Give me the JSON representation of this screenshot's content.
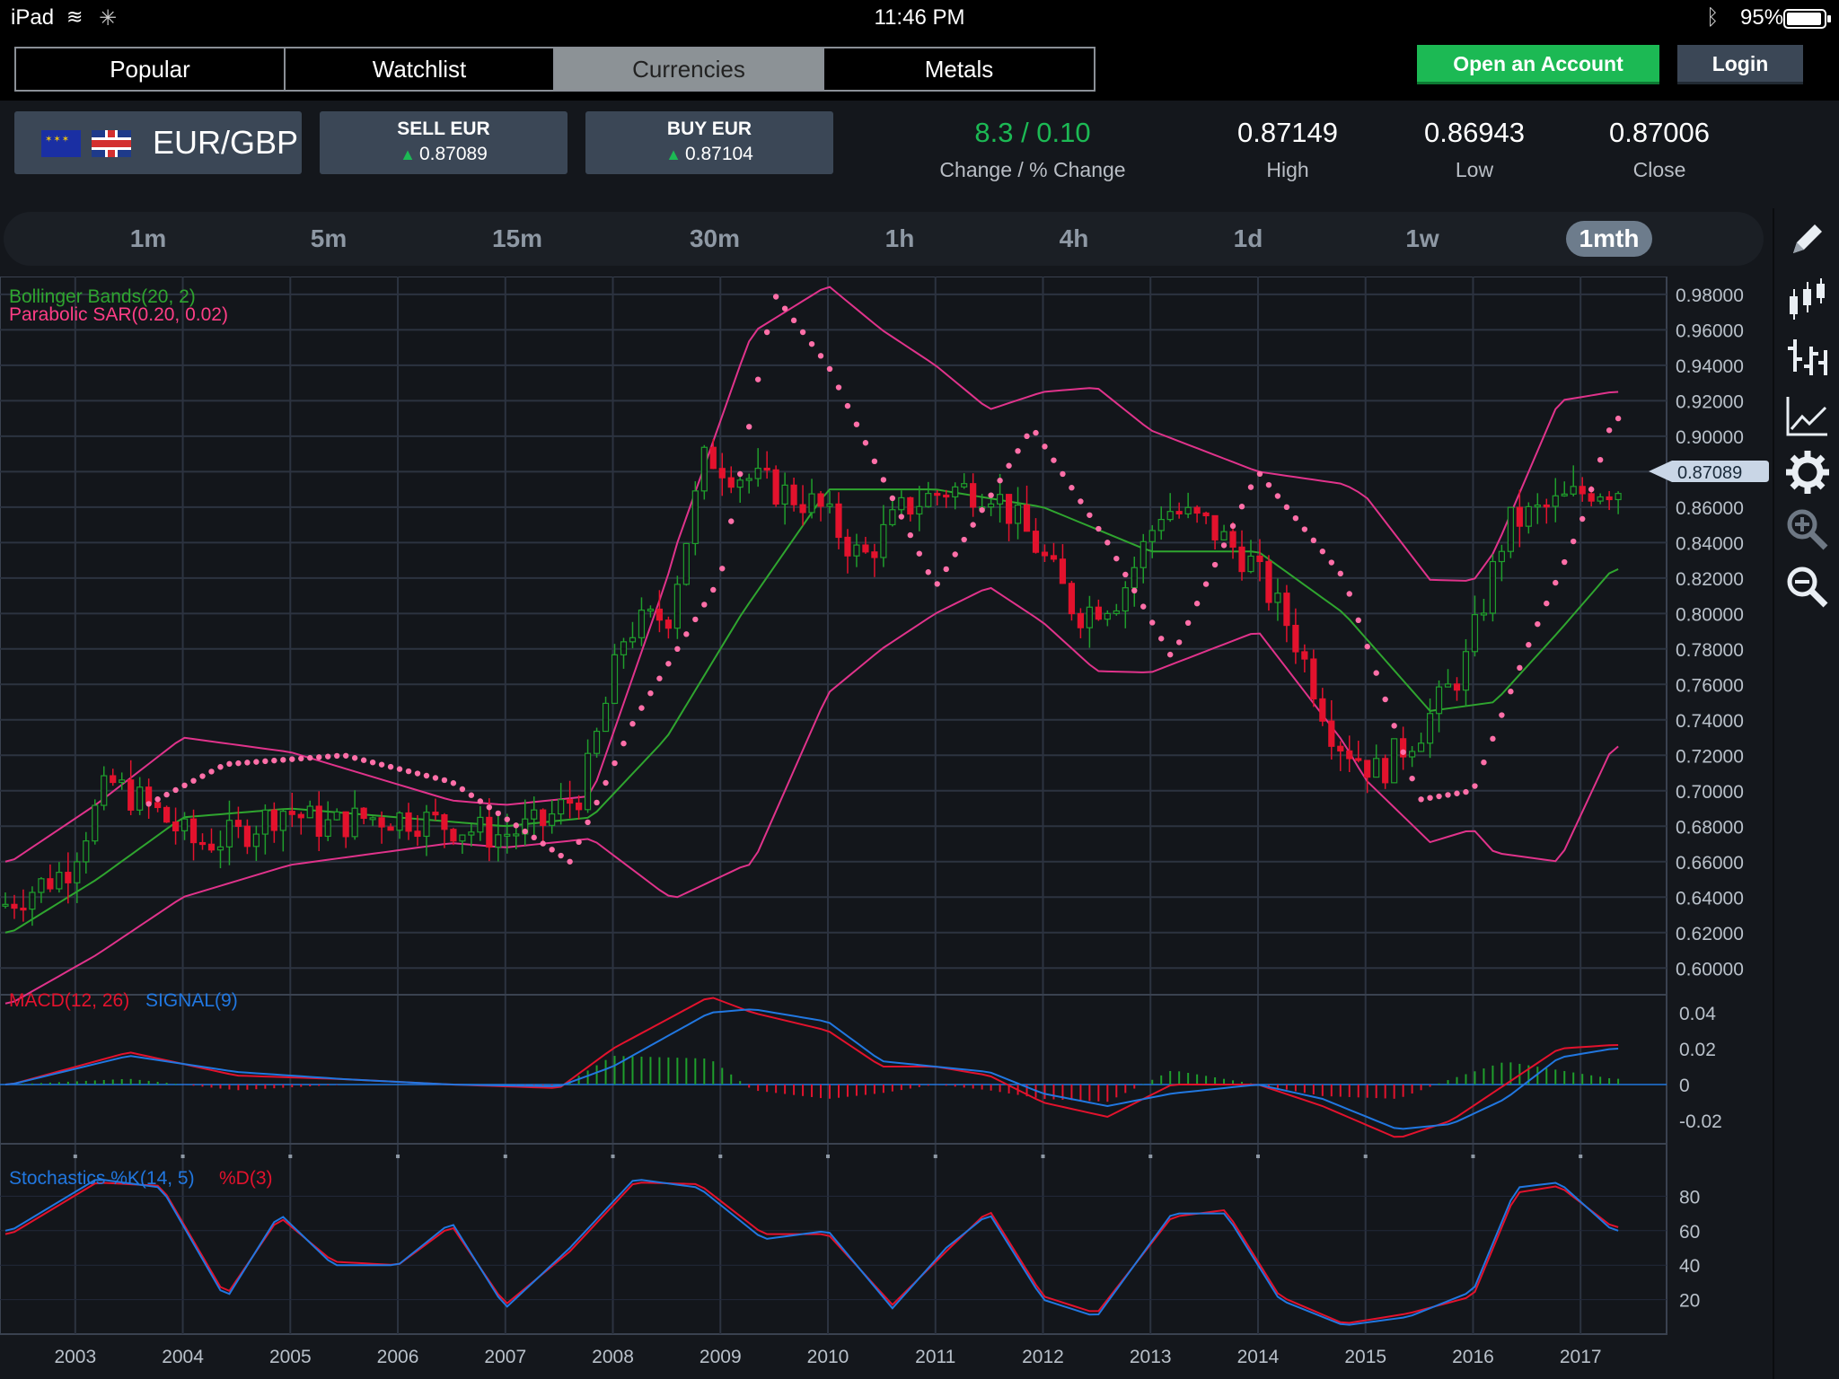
{
  "status_bar": {
    "device": "iPad",
    "time": "11:46 PM",
    "battery": "95%"
  },
  "nav": {
    "tabs": [
      {
        "label": "Popular",
        "active": false
      },
      {
        "label": "Watchlist",
        "active": false
      },
      {
        "label": "Currencies",
        "active": true
      },
      {
        "label": "Metals",
        "active": false
      }
    ],
    "open_account": "Open an Account",
    "login": "Login"
  },
  "instrument": {
    "pair": "EUR/GBP",
    "sell_label": "SELL EUR",
    "sell_price": "0.87089",
    "buy_label": "BUY EUR",
    "buy_price": "0.87104",
    "change": "8.3 / 0.10",
    "change_label": "Change / % Change",
    "high": "0.87149",
    "high_label": "High",
    "low": "0.86943",
    "low_label": "Low",
    "close": "0.87006",
    "close_label": "Close"
  },
  "timeframes": [
    "1m",
    "5m",
    "15m",
    "30m",
    "1h",
    "4h",
    "1d",
    "1w",
    "1mth"
  ],
  "active_timeframe": "1mth",
  "tools": [
    "pencil-icon",
    "candlestick-icon",
    "ohlc-bars-icon",
    "line-chart-icon",
    "settings-gear-icon",
    "zoom-in-icon",
    "zoom-out-icon"
  ],
  "colors": {
    "up": "#1f9e2c",
    "down": "#e3122d",
    "boll_mid": "#2fa52f",
    "boll_band": "#e0338b",
    "sar": "#ff6fa8",
    "macd": "#e3122d",
    "signal": "#2177e0",
    "stoch_k": "#2177e0",
    "stoch_d": "#e3122d"
  },
  "chart_data": [
    {
      "type": "candlestick",
      "indicators_legend": [
        "Bollinger Bands(20, 2)",
        "Parabolic SAR(0.20, 0.02)"
      ],
      "current_price_label": "0.87089",
      "y_ticks": [
        "0.98000",
        "0.96000",
        "0.94000",
        "0.92000",
        "0.90000",
        "0.88000",
        "0.86000",
        "0.84000",
        "0.82000",
        "0.80000",
        "0.78000",
        "0.76000",
        "0.74000",
        "0.72000",
        "0.70000",
        "0.68000",
        "0.66000",
        "0.64000",
        "0.62000",
        "0.60000"
      ],
      "ylim": [
        0.59,
        0.985
      ],
      "x_ticks": [
        "2003",
        "2004",
        "2005",
        "2006",
        "2007",
        "2008",
        "2009",
        "2010",
        "2011",
        "2012",
        "2013",
        "2014",
        "2015",
        "2016",
        "2017"
      ],
      "xlim": [
        2002.3,
        2017.8
      ],
      "series": [
        {
          "name": "EUR/GBP",
          "x": [
            2002.4,
            2003.0,
            2003.4,
            2003.8,
            2004.2,
            2004.6,
            2005.0,
            2005.4,
            2005.8,
            2006.2,
            2006.6,
            2007.0,
            2007.4,
            2007.8,
            2008.2,
            2008.6,
            2008.95,
            2009.2,
            2009.6,
            2010.0,
            2010.4,
            2010.8,
            2011.2,
            2011.6,
            2012.0,
            2012.4,
            2012.8,
            2013.2,
            2013.6,
            2014.0,
            2014.4,
            2014.8,
            2015.2,
            2015.6,
            2016.0,
            2016.4,
            2016.8,
            2017.2
          ],
          "values": [
            0.635,
            0.655,
            0.705,
            0.69,
            0.67,
            0.675,
            0.69,
            0.68,
            0.685,
            0.685,
            0.68,
            0.675,
            0.68,
            0.7,
            0.79,
            0.8,
            0.89,
            0.88,
            0.87,
            0.86,
            0.83,
            0.86,
            0.87,
            0.87,
            0.84,
            0.8,
            0.81,
            0.86,
            0.85,
            0.83,
            0.79,
            0.73,
            0.71,
            0.735,
            0.77,
            0.85,
            0.86,
            0.87089
          ]
        },
        {
          "name": "Bollinger Bands(20, 2)",
          "x": [
            2002.4,
            2003.2,
            2004.0,
            2005.0,
            2006.0,
            2007.0,
            2007.8,
            2008.5,
            2009.2,
            2010.0,
            2011.0,
            2012.0,
            2013.0,
            2014.0,
            2014.8,
            2015.6,
            2016.2,
            2016.8,
            2017.3
          ],
          "values": [
            0.62,
            0.65,
            0.685,
            0.69,
            0.685,
            0.68,
            0.685,
            0.73,
            0.8,
            0.87,
            0.87,
            0.86,
            0.835,
            0.835,
            0.8,
            0.745,
            0.75,
            0.79,
            0.825
          ]
        },
        {
          "name": "Parabolic SAR(0.20, 0.02)",
          "x": [
            2003.6,
            2004.4,
            2005.5,
            2006.5,
            2007.6,
            2008.2,
            2009.0,
            2009.5,
            2010.0,
            2011.0,
            2011.9,
            2012.6,
            2013.2,
            2014.0,
            2014.8,
            2015.5,
            2016.0,
            2016.5,
            2017.0,
            2017.3
          ],
          "values": [
            0.69,
            0.715,
            0.72,
            0.705,
            0.66,
            0.74,
            0.82,
            0.98,
            0.94,
            0.815,
            0.905,
            0.84,
            0.775,
            0.88,
            0.82,
            0.695,
            0.7,
            0.78,
            0.85,
            0.91
          ]
        }
      ]
    },
    {
      "type": "line",
      "legend": [
        "MACD(12, 26)",
        "SIGNAL(9)"
      ],
      "y_ticks": [
        "0.04",
        "0.02",
        "0",
        "-0.02"
      ],
      "ylim": [
        -0.03,
        0.05
      ],
      "x": [
        2002.4,
        2003.5,
        2004.5,
        2005.5,
        2006.5,
        2007.5,
        2008.0,
        2008.9,
        2009.3,
        2010.0,
        2010.5,
        2011.0,
        2011.5,
        2012.0,
        2012.6,
        2013.2,
        2014.0,
        2014.6,
        2015.3,
        2015.8,
        2016.3,
        2016.8,
        2017.3
      ],
      "series": [
        {
          "name": "MACD(12, 26)",
          "values": [
            0.0,
            0.018,
            0.005,
            0.003,
            0.0,
            -0.002,
            0.02,
            0.049,
            0.04,
            0.03,
            0.01,
            0.01,
            0.005,
            -0.01,
            -0.018,
            0.0,
            0.0,
            -0.012,
            -0.03,
            -0.02,
            0.0,
            0.02,
            0.022
          ]
        },
        {
          "name": "SIGNAL(9)",
          "values": [
            0.0,
            0.016,
            0.007,
            0.003,
            0.0,
            -0.001,
            0.01,
            0.04,
            0.042,
            0.035,
            0.013,
            0.01,
            0.007,
            -0.005,
            -0.012,
            -0.005,
            0.0,
            -0.008,
            -0.025,
            -0.022,
            -0.008,
            0.015,
            0.02
          ]
        }
      ]
    },
    {
      "type": "line",
      "legend": [
        "Stochastics %K(14, 5)",
        "%D(3)"
      ],
      "y_ticks": [
        "80",
        "60",
        "40",
        "20"
      ],
      "ylim": [
        0,
        100
      ],
      "x": [
        2002.4,
        2003.2,
        2003.8,
        2004.4,
        2004.9,
        2005.4,
        2006.0,
        2006.5,
        2007.0,
        2007.6,
        2008.2,
        2008.8,
        2009.4,
        2010.0,
        2010.6,
        2011.1,
        2011.5,
        2012.0,
        2012.5,
        2013.2,
        2013.7,
        2014.2,
        2014.8,
        2015.4,
        2016.0,
        2016.4,
        2016.8,
        2017.3
      ],
      "series": [
        {
          "name": "Stochastics %K(14, 5)",
          "values": [
            60,
            90,
            85,
            20,
            70,
            40,
            40,
            65,
            15,
            50,
            90,
            85,
            55,
            60,
            15,
            50,
            70,
            20,
            10,
            70,
            70,
            20,
            5,
            10,
            25,
            85,
            88,
            60
          ]
        },
        {
          "name": "%D(3)",
          "values": [
            58,
            88,
            86,
            22,
            68,
            42,
            40,
            63,
            17,
            48,
            88,
            87,
            58,
            58,
            17,
            48,
            72,
            22,
            12,
            68,
            72,
            22,
            6,
            12,
            22,
            82,
            86,
            62
          ]
        }
      ]
    }
  ]
}
